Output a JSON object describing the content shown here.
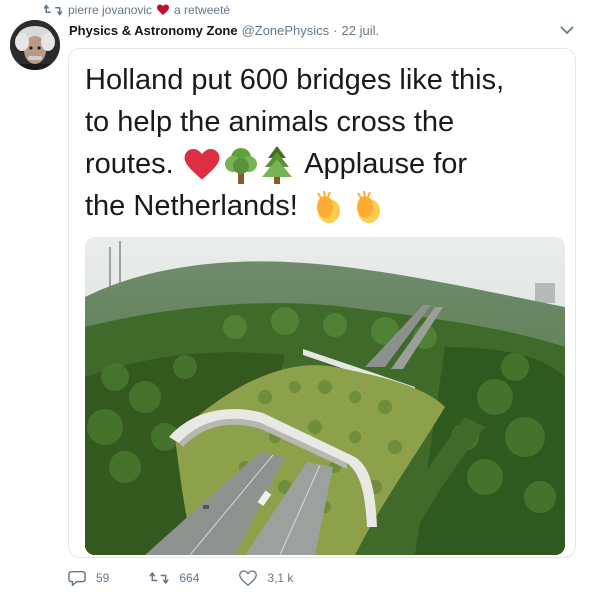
{
  "retweeter": {
    "name": "pierre jovanovic",
    "action": "a retweeté"
  },
  "tweet": {
    "author_name": "Physics & Astronomy Zone",
    "author_handle": "@ZonePhysics",
    "separator": "·",
    "date": "22 juil.",
    "caption_lines": [
      "Holland put 600 bridges like this,",
      "to help the animals cross the",
      "routes.",
      "Applause for",
      "the Netherlands!"
    ],
    "caption_emojis": [
      "red-heart-emoji",
      "deciduous-tree-emoji",
      "evergreen-tree-emoji",
      "clapping-hands-emoji",
      "clapping-hands-emoji"
    ]
  },
  "actions": {
    "replies": "59",
    "retweets": "664",
    "likes": "3,1 k"
  },
  "colors": {
    "accent_gray": "#657786",
    "heart_red": "#e0245e",
    "border": "#e1e8ed"
  },
  "icons": [
    "retweet-icon",
    "heart-icon",
    "chevron-down-icon",
    "reply-icon",
    "retweet-action-icon",
    "like-icon"
  ]
}
